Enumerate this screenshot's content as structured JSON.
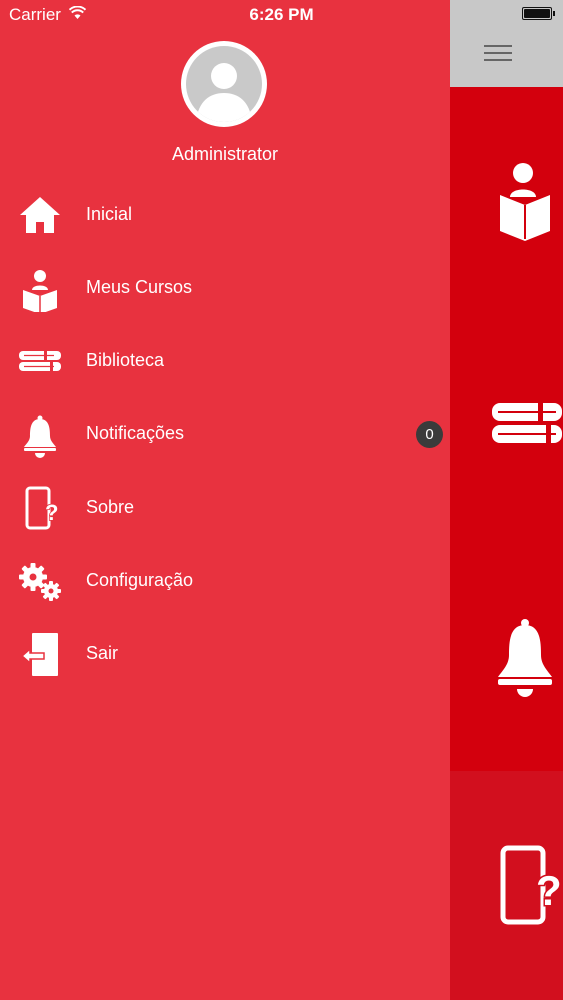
{
  "status_bar": {
    "carrier": "Carrier",
    "time": "6:26 PM"
  },
  "drawer": {
    "user_name": "Administrator",
    "items": [
      {
        "label": "Inicial",
        "icon": "home-icon"
      },
      {
        "label": "Meus Cursos",
        "icon": "reader-icon"
      },
      {
        "label": "Biblioteca",
        "icon": "books-icon"
      },
      {
        "label": "Notificações",
        "icon": "bell-icon",
        "badge": "0"
      },
      {
        "label": "Sobre",
        "icon": "phone-help-icon"
      },
      {
        "label": "Configuração",
        "icon": "gears-icon"
      },
      {
        "label": "Sair",
        "icon": "exit-icon"
      }
    ]
  },
  "main": {
    "tiles": [
      {
        "icon": "reader-icon"
      },
      {
        "icon": "books-icon"
      },
      {
        "icon": "bell-icon"
      },
      {
        "icon": "phone-help-icon"
      }
    ],
    "colors": {
      "tile": "#d3000d",
      "tile_alt": "#d20f1e",
      "header": "#c8c8c8"
    }
  },
  "colors": {
    "drawer_bg": "#e8323f",
    "badge_bg": "#3b3b3b",
    "text": "#ffffff"
  }
}
